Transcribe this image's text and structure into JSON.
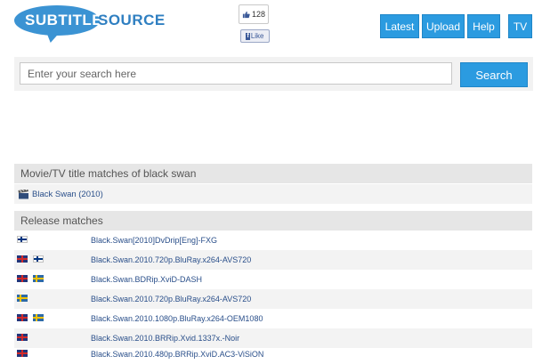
{
  "logo": {
    "word1": "SUBTITLE",
    "word2": "SOURCE"
  },
  "like_widget": {
    "count": "128",
    "button_label": "Like"
  },
  "nav": [
    {
      "label": "Latest"
    },
    {
      "label": "Upload"
    },
    {
      "label": "Help"
    },
    {
      "label": "TV"
    }
  ],
  "search": {
    "placeholder": "Enter your search here",
    "value": "",
    "button_label": "Search"
  },
  "title_matches": {
    "heading": "Movie/TV title matches of black swan",
    "items": [
      {
        "icon": "clapperboard-icon",
        "label": "Black Swan (2010)"
      }
    ]
  },
  "release_matches": {
    "heading": "Release matches",
    "rows": [
      {
        "flags": [
          "fi"
        ],
        "name": "Black.Swan[2010]DvDrip[Eng]-FXG"
      },
      {
        "flags": [
          "uk",
          "fi"
        ],
        "name": "Black.Swan.2010.720p.BluRay.x264-AVS720"
      },
      {
        "flags": [
          "uk",
          "se"
        ],
        "name": "Black.Swan.BDRip.XviD-DASH"
      },
      {
        "flags": [
          "se"
        ],
        "name": "Black.Swan.2010.720p.BluRay.x264-AVS720"
      },
      {
        "flags": [
          "uk",
          "se"
        ],
        "name": "Black.Swan.2010.1080p.BluRay.x264-OEM1080"
      },
      {
        "flags": [
          "uk"
        ],
        "name": "Black.Swan.2010.BRRip.Xvid.1337x.-Noir"
      },
      {
        "flags": [
          "uk"
        ],
        "name": "Black.Swan.2010.480p.BRRip.XviD.AC3-ViSiON"
      }
    ]
  },
  "colors": {
    "accent": "#2b9be0",
    "logo_blue": "#3b93d3",
    "link": "#2a4f8a"
  }
}
